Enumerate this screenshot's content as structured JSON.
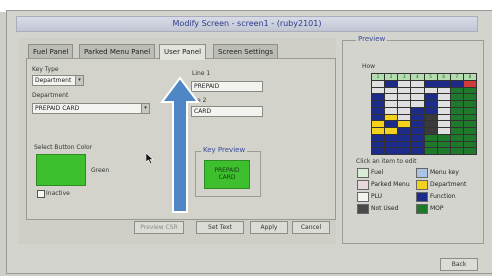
{
  "window": {
    "title": "Modify Screen - screen1 - (ruby2101)"
  },
  "tabs": [
    {
      "label": "Fuel Panel"
    },
    {
      "label": "Parked Menu Panel"
    },
    {
      "label": "User Panel"
    },
    {
      "label": "Screen Settings"
    }
  ],
  "user_panel": {
    "key_type_label": "Key Type",
    "key_type_value": "Department",
    "department_label": "Department",
    "department_value": "PREPAID CARD",
    "line1_label": "Line 1",
    "line1_value": "PREPAID",
    "line2_label": "e 2",
    "line2_value": "CARD",
    "button_color_label": "Select Button Color",
    "button_color_name": "Green",
    "button_color_hex": "#3dbf2e",
    "inactive_label": "Inactive",
    "key_preview_title": "Key Preview",
    "key_preview_line1": "PREPAID",
    "key_preview_line2": "CARD"
  },
  "buttons": {
    "preview_csr": "Preview CSR",
    "set_text": "Set Text",
    "apply": "Apply",
    "cancel": "Cancel",
    "back": "Back"
  },
  "preview": {
    "title": "Preview",
    "rows_label": "How",
    "grid_columns_header": [
      "1",
      "2",
      "3",
      "4",
      "5",
      "6",
      "7",
      "8"
    ],
    "grid_colors": [
      [
        "#b6ddb0",
        "#b6ddb0",
        "#b6ddb0",
        "#b6ddb0",
        "#b6ddb0",
        "#b6ddb0",
        "#b6ddb0",
        "#b6ddb0"
      ],
      [
        "#e0e0e0",
        "#1c2b8a",
        "#e0e0e0",
        "#e0e0e0",
        "#1c2b8a",
        "#1c2b8a",
        "#1c2b8a",
        "#d23b3b"
      ],
      [
        "#e0e0e0",
        "#e0e0e0",
        "#e0e0e0",
        "#e0e0e0",
        "#e0e0e0",
        "#e0e0e0",
        "#1e7a2a",
        "#1e7a2a"
      ],
      [
        "#1c2b8a",
        "#e0e0e0",
        "#e0e0e0",
        "#e0e0e0",
        "#1c2b8a",
        "#e0e0e0",
        "#1e7a2a",
        "#1e7a2a"
      ],
      [
        "#1c2b8a",
        "#e0e0e0",
        "#e0e0e0",
        "#e0e0e0",
        "#1c2b8a",
        "#e0e0e0",
        "#1e7a2a",
        "#1e7a2a"
      ],
      [
        "#1c2b8a",
        "#e0e0e0",
        "#e0e0e0",
        "#1c2b8a",
        "#1c2b8a",
        "#e0e0e0",
        "#1e7a2a",
        "#1e7a2a"
      ],
      [
        "#1c2b8a",
        "#f2d21c",
        "#e0e0e0",
        "#1c2b8a",
        "#3a3a3a",
        "#e0e0e0",
        "#1e7a2a",
        "#1e7a2a"
      ],
      [
        "#f2d21c",
        "#1c2b8a",
        "#f2d21c",
        "#1c2b8a",
        "#3a3a3a",
        "#e0e0e0",
        "#1e7a2a",
        "#1e7a2a"
      ],
      [
        "#f2d21c",
        "#f2d21c",
        "#1c2b8a",
        "#1c2b8a",
        "#3a3a3a",
        "#e0e0e0",
        "#1e7a2a",
        "#1e7a2a"
      ],
      [
        "#1c2b8a",
        "#1c2b8a",
        "#1c2b8a",
        "#1c2b8a",
        "#1e7a2a",
        "#1e7a2a",
        "#1e7a2a",
        "#1e7a2a"
      ],
      [
        "#1c2b8a",
        "#1c2b8a",
        "#1c2b8a",
        "#1c2b8a",
        "#1e7a2a",
        "#1e7a2a",
        "#1e7a2a",
        "#1e7a2a"
      ],
      [
        "#1c2b8a",
        "#1c2b8a",
        "#1c2b8a",
        "#1c2b8a",
        "#1e7a2a",
        "#1e7a2a",
        "#1e7a2a",
        "#1e7a2a"
      ]
    ],
    "click_hint": "Click an item to edit",
    "legend": [
      {
        "label": "Fuel",
        "color": "#d9ecd6"
      },
      {
        "label": "Menu key",
        "color": "#a9c4e4"
      },
      {
        "label": "Parked Menu",
        "color": "#e8d8dc"
      },
      {
        "label": "Department",
        "color": "#f2d21c"
      },
      {
        "label": "PLU",
        "color": "#f3f3ef"
      },
      {
        "label": "Function",
        "color": "#1c2b8a"
      },
      {
        "label": "Not Used",
        "color": "#4a4a4a"
      },
      {
        "label": "MOP",
        "color": "#1e7a2a"
      }
    ]
  },
  "annotation": {
    "arrow_color": "#4f86c6"
  }
}
